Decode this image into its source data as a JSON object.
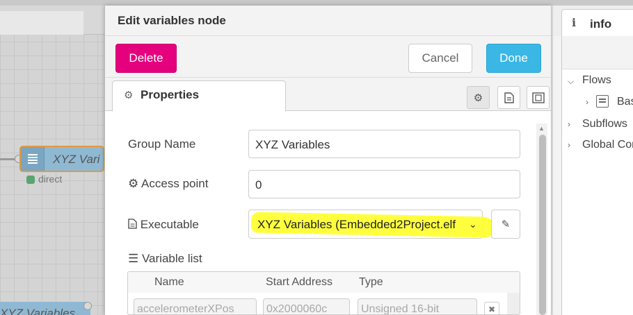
{
  "tray": {
    "title": "Edit variables node",
    "delete_label": "Delete",
    "cancel_label": "Cancel",
    "done_label": "Done",
    "tab_properties_label": "Properties"
  },
  "form": {
    "group_name_label": "Group Name",
    "group_name_value": "XYZ Variables",
    "access_point_label": "Access point",
    "access_point_value": "0",
    "executable_label": "Executable",
    "executable_value": "XYZ Variables (Embedded2Project.elf",
    "variable_list_label": "Variable list"
  },
  "variable_table": {
    "columns": [
      "Name",
      "Start Address",
      "Type"
    ],
    "rows": [
      {
        "name": "accelerometerXPos",
        "start_address": "0x2000060c",
        "type": "Unsigned 16-bit"
      }
    ]
  },
  "workspace": {
    "node_label": "XYZ Vari",
    "node_status": "direct",
    "node2_label": "XYZ Variables"
  },
  "sidebar": {
    "tab_icon": "i",
    "tab_label": "info",
    "tree": {
      "flows": "Flows",
      "flow_item": "Bas",
      "subflows": "Subflows",
      "global": "Global Con"
    }
  },
  "icons": {
    "properties_tab": "gear-icon",
    "access_point": "gear-icon",
    "executable": "document-icon",
    "variable_list": "list-icon",
    "edit_executable": "pencil-icon",
    "remove_row": "close-icon",
    "select_dropdown": "chevron-down-icon"
  },
  "colors": {
    "delete": "#e5007e",
    "done": "#3ab7e4",
    "highlight": "#ffff2e",
    "node": "#8fb9d3",
    "node_border": "#e49a3d",
    "status_dot": "#5aa470"
  }
}
